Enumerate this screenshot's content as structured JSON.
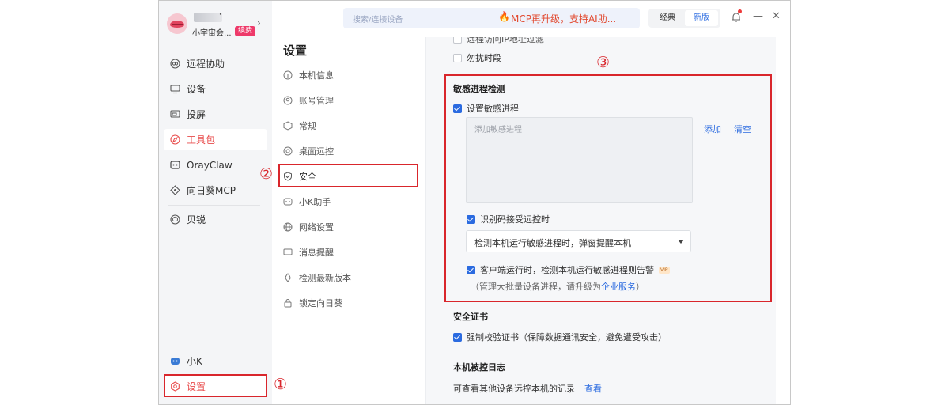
{
  "profile": {
    "name_mark": "'",
    "subtitle": "小宇宙会...",
    "badge": "续费"
  },
  "nav": {
    "items": [
      {
        "label": "远程协助",
        "icon": "remote-assist-icon"
      },
      {
        "label": "设备",
        "icon": "monitor-icon"
      },
      {
        "label": "投屏",
        "icon": "cast-screen-icon"
      },
      {
        "label": "工具包",
        "icon": "compass-icon",
        "active": true
      },
      {
        "label": "OrayClaw",
        "icon": "claw-icon"
      },
      {
        "label": "向日葵MCP",
        "icon": "mcp-icon"
      },
      {
        "label": "贝锐",
        "icon": "oray-icon"
      }
    ],
    "bottom": [
      {
        "label": "小K",
        "icon": "robot-icon"
      },
      {
        "label": "设置",
        "icon": "gear-icon"
      }
    ]
  },
  "topbar": {
    "search_placeholder": "搜索/连接设备",
    "promo": "MCP再升级，支持AI助...",
    "mode_classic": "经典",
    "mode_new": "新版"
  },
  "settings": {
    "title": "设置",
    "menu": [
      {
        "label": "本机信息",
        "icon": "info-icon"
      },
      {
        "label": "账号管理",
        "icon": "account-icon"
      },
      {
        "label": "常规",
        "icon": "cube-icon"
      },
      {
        "label": "桌面远控",
        "icon": "desktop-icon"
      },
      {
        "label": "安全",
        "icon": "shield-icon",
        "active": true
      },
      {
        "label": "小K助手",
        "icon": "robot-icon"
      },
      {
        "label": "网络设置",
        "icon": "globe-icon"
      },
      {
        "label": "消息提醒",
        "icon": "message-icon"
      },
      {
        "label": "检测最新版本",
        "icon": "update-icon"
      },
      {
        "label": "锁定向日葵",
        "icon": "lock-icon"
      }
    ]
  },
  "content": {
    "partial_top": "远程访问IP地址过滤",
    "dnd_label": "勿扰时段",
    "sensitive": {
      "title": "敏感进程检测",
      "set_label": "设置敏感进程",
      "proc_placeholder": "添加敏感进程",
      "add_link": "添加",
      "clear_link": "清空",
      "ident_label": "识别码接受远控时",
      "select_value": "检测本机运行敏感进程时，弹窗提醒本机",
      "client_label": "客户端运行时，检测本机运行敏感进程则告警",
      "vip": "VIP",
      "note_prefix": "（管理大批量设备进程，请升级为",
      "note_link": "企业服务",
      "note_suffix": "）"
    },
    "cert": {
      "title": "安全证书",
      "label": "强制校验证书（保障数据通讯安全，避免遭受攻击）"
    },
    "log": {
      "title": "本机被控日志",
      "desc": "可查看其他设备远控本机的记录",
      "link": "查看"
    }
  },
  "annotations": {
    "one": "①",
    "two": "②",
    "three": "③"
  }
}
